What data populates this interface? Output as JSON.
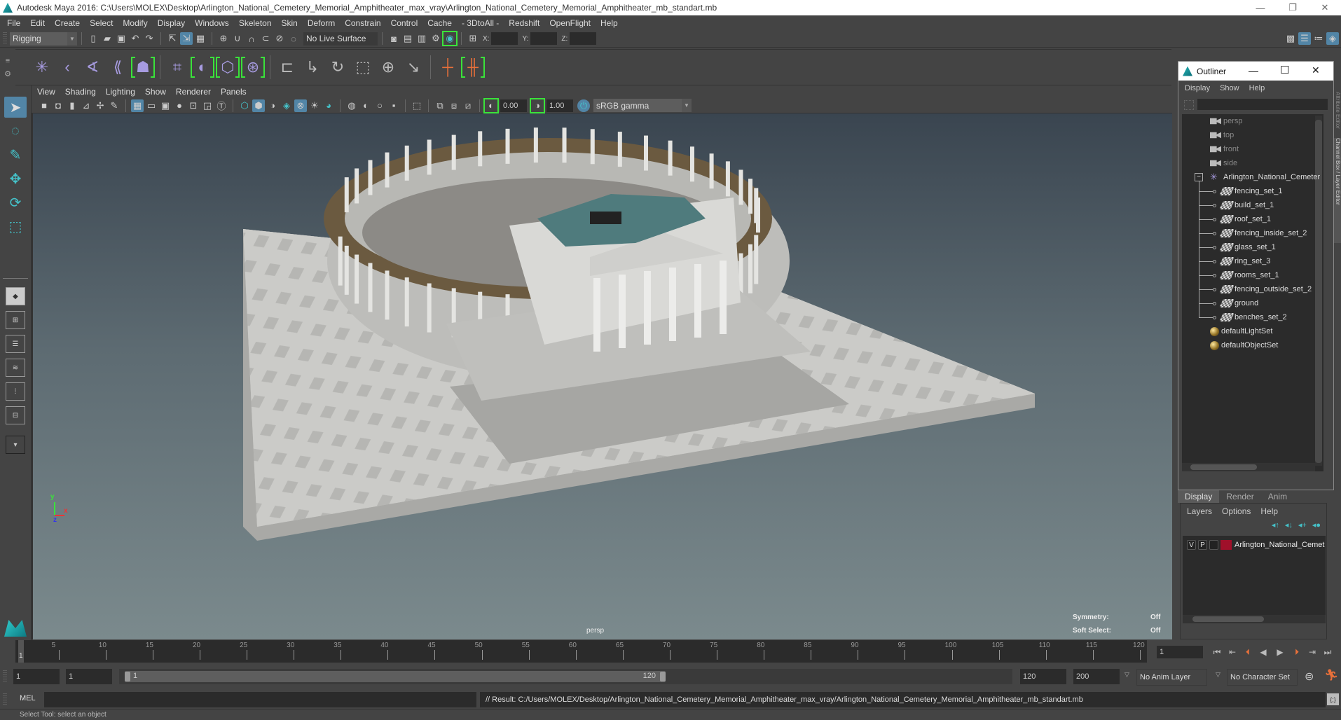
{
  "window": {
    "title": "Autodesk Maya 2016: C:\\Users\\MOLEX\\Desktop\\Arlington_National_Cemetery_Memorial_Amphitheater_max_vray\\Arlington_National_Cemetery_Memorial_Amphitheater_mb_standart.mb",
    "controls": {
      "minimize": "—",
      "restore": "❐",
      "close": "✕"
    }
  },
  "menubar": [
    "File",
    "Edit",
    "Create",
    "Select",
    "Modify",
    "Display",
    "Windows",
    "Skeleton",
    "Skin",
    "Deform",
    "Constrain",
    "Control",
    "Cache",
    "- 3DtoAll -",
    "Redshift",
    "OpenFlight",
    "Help"
  ],
  "statusline": {
    "menu_set": "Rigging",
    "live_surface": "No Live Surface",
    "x_label": "X:",
    "y_label": "Y:",
    "z_label": "Z:",
    "x_value": "",
    "y_value": "",
    "z_value": ""
  },
  "shelf": {
    "icons": [
      "joint-tool",
      "ik-handle",
      "ik-spline",
      "create-blend",
      "humanik",
      "paint-weights",
      "smooth-skin",
      "wrap",
      "lattice",
      "cluster-parent",
      "parent-constraint",
      "point-constraint",
      "orient-constraint",
      "scale-constraint",
      "aim-constraint",
      "pole-vector",
      "mirror-joint",
      "hik-connect"
    ]
  },
  "toolbox": {
    "tools": [
      "select-tool",
      "lasso-tool",
      "paint-select-tool",
      "move-tool",
      "rotate-tool",
      "scale-tool"
    ],
    "selected": "select-tool"
  },
  "panel": {
    "menus": [
      "View",
      "Shading",
      "Lighting",
      "Show",
      "Renderer",
      "Panels"
    ],
    "exposure": "0.00",
    "gamma": "1.00",
    "color_space": "sRGB gamma"
  },
  "viewport": {
    "camera": "persp",
    "hud": [
      {
        "label": "Symmetry:",
        "value": "Off"
      },
      {
        "label": "Soft Select:",
        "value": "Off"
      }
    ],
    "axis": {
      "x": "x",
      "y": "y",
      "z": "z"
    },
    "colors": {
      "bg_top": "#3a4550",
      "bg_bottom": "#7b8a8d",
      "stone": "#cfcfcd",
      "roof": "#4f7b7d",
      "ring_top": "#6b5a40"
    }
  },
  "outliner": {
    "title": "Outliner",
    "menus": [
      "Display",
      "Show",
      "Help"
    ],
    "items": [
      {
        "label": "persp",
        "type": "camera",
        "indent": 0
      },
      {
        "label": "top",
        "type": "camera",
        "indent": 0
      },
      {
        "label": "front",
        "type": "camera",
        "indent": 0
      },
      {
        "label": "side",
        "type": "camera",
        "indent": 0
      },
      {
        "label": "Arlington_National_Cemeter",
        "type": "group",
        "indent": 0,
        "expanded": true
      },
      {
        "label": "fencing_set_1",
        "type": "set",
        "indent": 1
      },
      {
        "label": "build_set_1",
        "type": "set",
        "indent": 1
      },
      {
        "label": "roof_set_1",
        "type": "set",
        "indent": 1
      },
      {
        "label": "fencing_inside_set_2",
        "type": "set",
        "indent": 1
      },
      {
        "label": "glass_set_1",
        "type": "set",
        "indent": 1
      },
      {
        "label": "ring_set_3",
        "type": "set",
        "indent": 1
      },
      {
        "label": "rooms_set_1",
        "type": "set",
        "indent": 1
      },
      {
        "label": "fencing_outside_set_2",
        "type": "set",
        "indent": 1
      },
      {
        "label": "ground",
        "type": "set",
        "indent": 1
      },
      {
        "label": "benches_set_2",
        "type": "set",
        "indent": 1
      },
      {
        "label": "defaultLightSet",
        "type": "objectset",
        "indent": 0
      },
      {
        "label": "defaultObjectSet",
        "type": "objectset",
        "indent": 0
      }
    ]
  },
  "side_tabs": [
    "Attribute Editor",
    "Channel Box / Layer Editor"
  ],
  "layer_editor": {
    "tabs": [
      "Display",
      "Render",
      "Anim"
    ],
    "active_tab": "Display",
    "menus": [
      "Layers",
      "Options",
      "Help"
    ],
    "layers": [
      {
        "v": "V",
        "p": "P",
        "color": "#a0102a",
        "name": "Arlington_National_Cemet"
      }
    ]
  },
  "timeline": {
    "ticks": [
      5,
      10,
      15,
      20,
      25,
      30,
      35,
      40,
      45,
      50,
      55,
      60,
      65,
      70,
      75,
      80,
      85,
      90,
      95,
      100,
      105,
      110,
      115,
      120
    ],
    "start": 1,
    "end": 120,
    "current_frame": "1",
    "current_frame_marker": "1"
  },
  "range": {
    "start_time": "1",
    "playback_start": "1",
    "slider_start": "1",
    "slider_end": "120",
    "playback_end": "120",
    "end_time": "200",
    "anim_layer": "No Anim Layer",
    "character_set": "No Character Set"
  },
  "command": {
    "language": "MEL",
    "input": "",
    "result": "// Result: C:/Users/MOLEX/Desktop/Arlington_National_Cemetery_Memorial_Amphitheater_max_vray/Arlington_National_Cemetery_Memorial_Amphitheater_mb_standart.mb"
  },
  "helpline": "Select Tool: select an object"
}
